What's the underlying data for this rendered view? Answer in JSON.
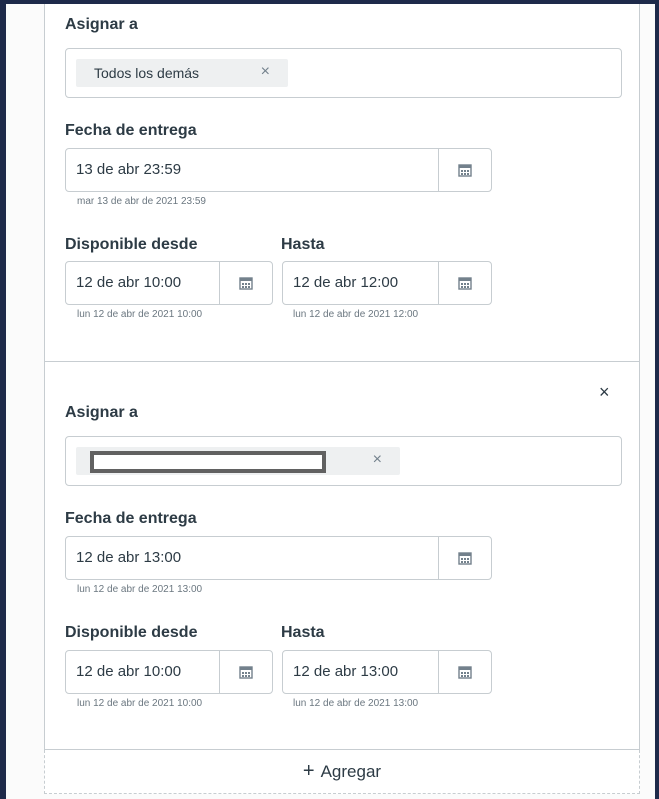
{
  "section1": {
    "assign_label": "Asignar a",
    "assign_tag": "Todos los demás",
    "tag_remove": "×",
    "due_label": "Fecha de entrega",
    "due_value": "13 de abr 23:59",
    "due_hint": "mar 13 de abr de 2021 23:59",
    "from_label": "Disponible desde",
    "from_value": "12 de abr 10:00",
    "from_hint": "lun 12 de abr de 2021 10:00",
    "until_label": "Hasta",
    "until_value": "12 de abr 12:00",
    "until_hint": "lun 12 de abr de 2021 12:00"
  },
  "section2": {
    "close": "×",
    "assign_label": "Asignar a",
    "tag_remove": "×",
    "due_label": "Fecha de entrega",
    "due_value": "12 de abr 13:00",
    "due_hint": "lun 12 de abr de 2021 13:00",
    "from_label": "Disponible desde",
    "from_value": "12 de abr 10:00",
    "from_hint": "lun 12 de abr de 2021 10:00",
    "until_label": "Hasta",
    "until_value": "12 de abr 13:00",
    "until_hint": "lun 12 de abr de 2021 13:00"
  },
  "add": {
    "plus": "+",
    "label": "Agregar"
  },
  "icons": {
    "calendar": "calendar-icon",
    "remove": "close-icon"
  }
}
